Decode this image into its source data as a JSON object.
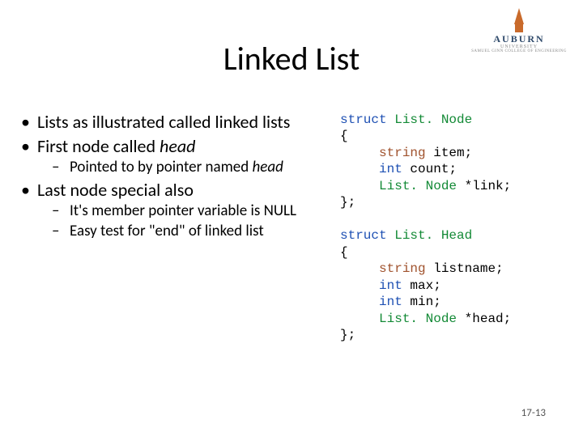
{
  "logo": {
    "university": "AUBURN",
    "line1": "UNIVERSITY",
    "line2": "SAMUEL GINN COLLEGE OF ENGINEERING"
  },
  "title": "Linked List",
  "bullets": {
    "b1": "Lists as illustrated called linked lists",
    "b2_pre": "First node called ",
    "b2_em": "head",
    "b2_sub_pre": "Pointed to by pointer named ",
    "b2_sub_em": "head",
    "b3": "Last node special also",
    "b3_sub1": "It's member pointer variable is NULL",
    "b3_sub2": "Easy test for \"end\" of linked list"
  },
  "code": {
    "kw_struct": "struct",
    "kw_int": "int",
    "typ_listnode": "List. Node",
    "typ_listhead": "List. Head",
    "typ_string": "string",
    "node_f1": " item;",
    "node_f2": " count;",
    "node_f3": " *link;",
    "head_f1": " listname;",
    "head_f2": " max;",
    "head_f3": " min;",
    "head_f4": " *head;",
    "brace_open": "{",
    "brace_close": "};"
  },
  "pagenum": "17-13"
}
